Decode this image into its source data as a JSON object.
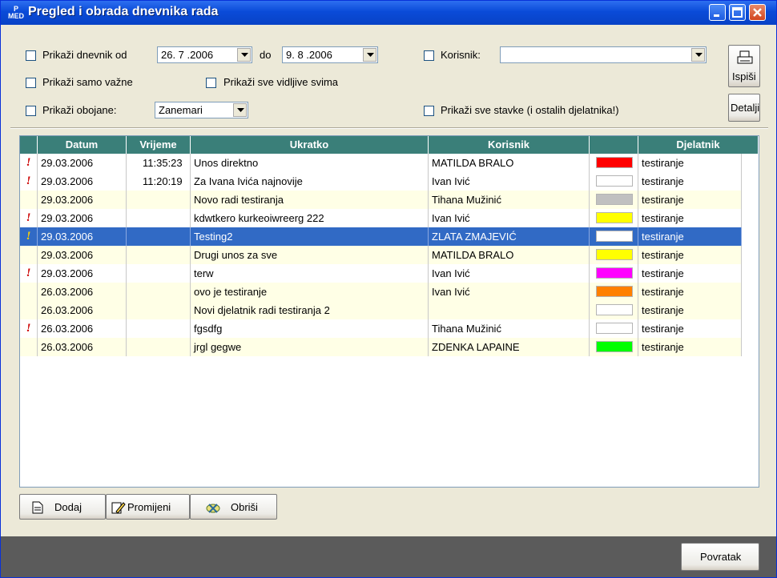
{
  "window": {
    "title": "Pregled i obrada dnevnika rada",
    "icon_text": [
      "P",
      "MED"
    ]
  },
  "filters": {
    "date_range_label": "Prikaži dnevnik od",
    "date_from": "26. 7 .2006",
    "date_to_label": "do",
    "date_to": "9. 8 .2006",
    "important_only_label": "Prikaži samo važne",
    "visible_to_all_label": "Prikaži sve vidljive svima",
    "colored_label": "Prikaži obojane:",
    "colored_value": "Zanemari",
    "user_label": "Korisnik:",
    "user_value": "",
    "all_items_label": "Prikaži sve stavke (i ostalih djelatnika!)"
  },
  "side_buttons": {
    "print_label": "Ispiši",
    "details_label": "Detalji"
  },
  "table": {
    "columns": [
      "",
      "Datum",
      "Vrijeme",
      "Ukratko",
      "Korisnik",
      "",
      "Djelatnik"
    ],
    "rows": [
      {
        "flag": "!",
        "date": "29.03.2006",
        "time": "11:35:23",
        "summary": "Unos direktno",
        "user": "MATILDA BRALO",
        "color": "#ff0000",
        "worker": "testiranje"
      },
      {
        "flag": "!",
        "date": "29.03.2006",
        "time": "11:20:19",
        "summary": "Za Ivana Ivića najnovije",
        "user": "Ivan Ivić",
        "color": "#ffffff",
        "worker": "testiranje"
      },
      {
        "flag": "",
        "date": "29.03.2006",
        "time": "",
        "summary": "Novo radi testiranja",
        "user": "Tihana Mužinić",
        "color": "#c0c0c0",
        "worker": "testiranje"
      },
      {
        "flag": "!",
        "date": "29.03.2006",
        "time": "",
        "summary": "kdwtkero kurkeoiwreerg 222",
        "user": "Ivan Ivić",
        "color": "#ffff00",
        "worker": "testiranje"
      },
      {
        "flag": "!",
        "date": "29.03.2006",
        "time": "",
        "summary": "Testing2",
        "user": "ZLATA ZMAJEVIĆ",
        "color": "#ffffff",
        "worker": "testiranje",
        "selected": true
      },
      {
        "flag": "",
        "date": "29.03.2006",
        "time": "",
        "summary": "Drugi unos za sve",
        "user": "MATILDA BRALO",
        "color": "#ffff00",
        "worker": "testiranje"
      },
      {
        "flag": "!",
        "date": "29.03.2006",
        "time": "",
        "summary": "terw",
        "user": "Ivan Ivić",
        "color": "#ff00ff",
        "worker": "testiranje"
      },
      {
        "flag": "",
        "date": "26.03.2006",
        "time": "",
        "summary": "ovo je testiranje",
        "user": "Ivan Ivić",
        "color": "#ff8000",
        "worker": "testiranje"
      },
      {
        "flag": "",
        "date": "26.03.2006",
        "time": "",
        "summary": "Novi djelatnik radi testiranja 2",
        "user": "",
        "color": "#ffffff",
        "worker": "testiranje"
      },
      {
        "flag": "!",
        "date": "26.03.2006",
        "time": "",
        "summary": "fgsdfg",
        "user": "Tihana Mužinić",
        "color": "#ffffff",
        "worker": "testiranje"
      },
      {
        "flag": "",
        "date": "26.03.2006",
        "time": "",
        "summary": "jrgl gegwe",
        "user": "ZDENKA LAPAINE",
        "color": "#00ff00",
        "worker": "testiranje"
      }
    ]
  },
  "actions": {
    "add_label": "Dodaj",
    "edit_label": "Promijeni",
    "delete_label": "Obriši"
  },
  "footer": {
    "back_label": "Povratak"
  },
  "colors": {
    "title_bar": "#0a4bd8",
    "grid_header": "#3a7f79",
    "row_alt": "#ffffe6",
    "selection": "#316ac5",
    "flag": "#cc0000"
  }
}
